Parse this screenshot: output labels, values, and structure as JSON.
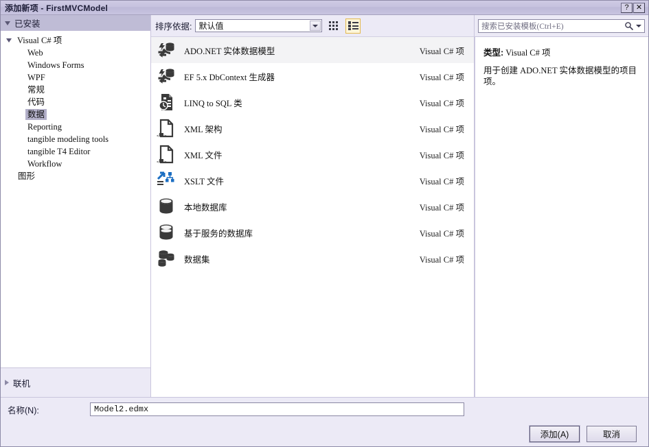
{
  "window": {
    "title": "添加新项 - FirstMVCModel",
    "help_button": "?",
    "close_button": "✕"
  },
  "left_panel": {
    "header": "已安装",
    "tree": [
      {
        "label": "Visual C# 项",
        "level": 0,
        "expanded": true,
        "selected": false
      },
      {
        "label": "Web",
        "level": 1,
        "selected": false
      },
      {
        "label": "Windows Forms",
        "level": 1,
        "selected": false
      },
      {
        "label": "WPF",
        "level": 1,
        "selected": false
      },
      {
        "label": "常规",
        "level": 1,
        "selected": false
      },
      {
        "label": "代码",
        "level": 1,
        "selected": false
      },
      {
        "label": "数据",
        "level": 1,
        "selected": true
      },
      {
        "label": "Reporting",
        "level": 1,
        "selected": false
      },
      {
        "label": "tangible modeling tools",
        "level": 1,
        "selected": false
      },
      {
        "label": "tangible T4 Editor",
        "level": 1,
        "selected": false
      },
      {
        "label": "Workflow",
        "level": 1,
        "selected": false
      },
      {
        "label": "图形",
        "level": 0.5,
        "selected": false
      }
    ],
    "online_label": "联机"
  },
  "toolbar": {
    "sort_label": "排序依据:",
    "sort_value": "默认值",
    "grid_view_title": "小图标视图",
    "list_view_title": "中等图标视图",
    "active_view": "list"
  },
  "templates": [
    {
      "name": "ADO.NET 实体数据模型",
      "kind": "Visual C# 项",
      "icon": "entity-model-icon",
      "selected": true
    },
    {
      "name": "EF 5.x DbContext 生成器",
      "kind": "Visual C# 项",
      "icon": "entity-model-icon",
      "selected": false
    },
    {
      "name": "LINQ to SQL 类",
      "kind": "Visual C# 项",
      "icon": "linq-to-sql-icon",
      "selected": false
    },
    {
      "name": "XML 架构",
      "kind": "Visual C# 项",
      "icon": "xml-schema-icon",
      "selected": false
    },
    {
      "name": "XML 文件",
      "kind": "Visual C# 项",
      "icon": "xml-file-icon",
      "selected": false
    },
    {
      "name": "XSLT 文件",
      "kind": "Visual C# 项",
      "icon": "xslt-file-icon",
      "selected": false
    },
    {
      "name": "本地数据库",
      "kind": "Visual C# 项",
      "icon": "local-database-icon",
      "selected": false
    },
    {
      "name": "基于服务的数据库",
      "kind": "Visual C# 项",
      "icon": "service-database-icon",
      "selected": false
    },
    {
      "name": "数据集",
      "kind": "Visual C# 项",
      "icon": "dataset-icon",
      "selected": false
    }
  ],
  "right_panel": {
    "search_placeholder": "搜索已安装模板(Ctrl+E)",
    "search_value": "",
    "detail_type_key": "类型:",
    "detail_type_value": "Visual C# 项",
    "detail_description": "用于创建 ADO.NET 实体数据模型的项目项。"
  },
  "footer": {
    "name_label": "名称(N):",
    "name_value": "Model2.edmx",
    "add_button": "添加(A)",
    "cancel_button": "取消"
  },
  "colors": {
    "dialog_bg": "#eceaf6",
    "titlebar": "#c6c2de",
    "panel_header": "#bfbcd6",
    "selection": "#b3b0c9",
    "row_selected": "#f3f3f5",
    "active_view_border": "#e3b94e",
    "icon_dark": "#3a3a3a",
    "icon_blue": "#1b6ec2"
  }
}
